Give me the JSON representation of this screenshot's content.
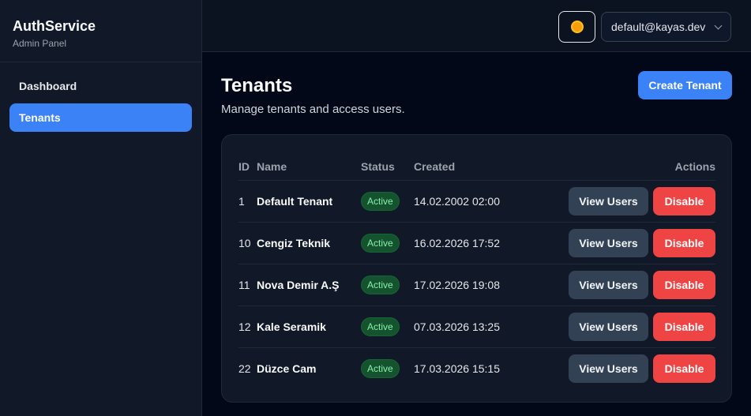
{
  "sidebar": {
    "brand_title": "AuthService",
    "brand_sub": "Admin Panel",
    "items": [
      {
        "label": "Dashboard",
        "active": false
      },
      {
        "label": "Tenants",
        "active": true
      }
    ]
  },
  "header": {
    "theme_icon": "sun-icon",
    "user_email": "default@kayas.dev"
  },
  "main": {
    "title": "Tenants",
    "subtitle": "Manage tenants and access users.",
    "create_label": "Create Tenant"
  },
  "table": {
    "columns": {
      "id": "ID",
      "name": "Name",
      "status": "Status",
      "created": "Created",
      "actions": "Actions"
    },
    "view_label": "View Users",
    "disable_label": "Disable",
    "rows": [
      {
        "id": "1",
        "name": "Default Tenant",
        "status": "Active",
        "created": "14.02.2002 02:00"
      },
      {
        "id": "10",
        "name": "Cengiz Teknik",
        "status": "Active",
        "created": "16.02.2026 17:52"
      },
      {
        "id": "11",
        "name": "Nova Demir A.Ş",
        "status": "Active",
        "created": "17.02.2026 19:08"
      },
      {
        "id": "12",
        "name": "Kale Seramik",
        "status": "Active",
        "created": "07.03.2026 13:25"
      },
      {
        "id": "22",
        "name": "Düzce Cam",
        "status": "Active",
        "created": "17.03.2026 15:15"
      }
    ]
  },
  "colors": {
    "accent": "#3b82f6",
    "danger": "#ef4444",
    "active_badge": "#14532d"
  }
}
